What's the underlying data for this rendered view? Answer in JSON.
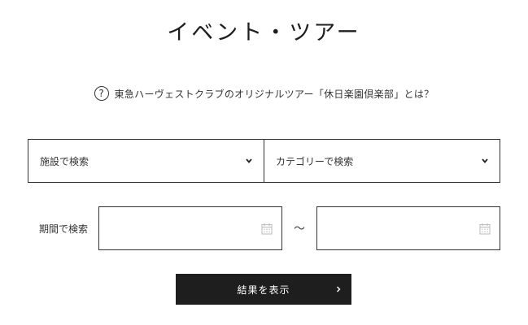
{
  "page": {
    "title": "イベント・ツアー"
  },
  "info": {
    "icon": "question-circle-icon",
    "link_text": "東急ハーヴェストクラブのオリジナルツアー「休日楽園倶楽部」とは？"
  },
  "filters": {
    "facility_select": {
      "selected": "施設で検索",
      "icon": "chevron-down-icon"
    },
    "category_select": {
      "selected": "カテゴリーで検索",
      "icon": "chevron-down-icon"
    }
  },
  "period": {
    "label": "期間で検索",
    "separator": "～",
    "start_date": {
      "value": "",
      "icon": "calendar-icon"
    },
    "end_date": {
      "value": "",
      "icon": "calendar-icon"
    }
  },
  "submit": {
    "label": "結果を表示",
    "arrow": "›",
    "background": "#1e1e1e",
    "text_color": "#ffffff"
  }
}
